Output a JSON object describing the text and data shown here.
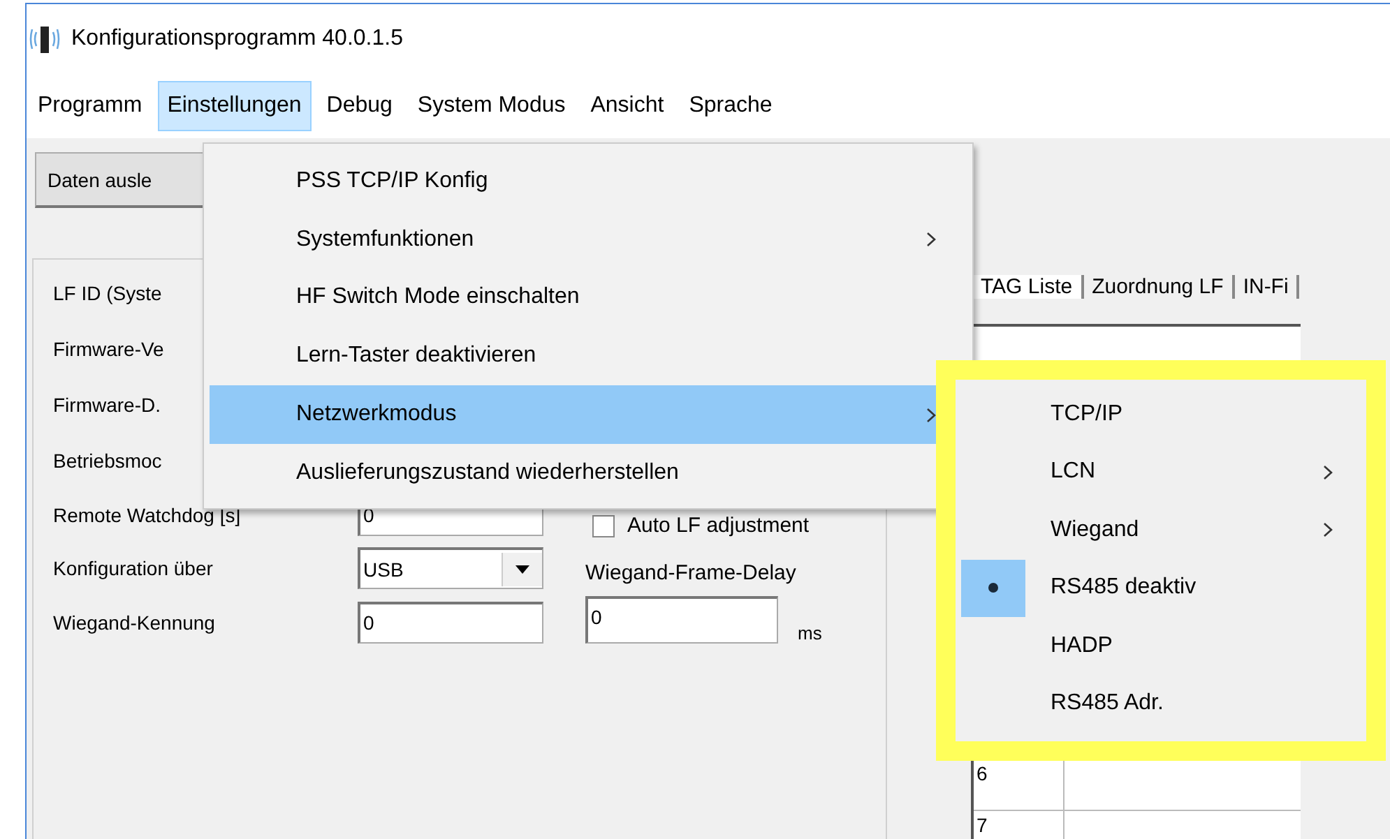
{
  "window": {
    "title": "Konfigurationsprogramm 40.0.1.5"
  },
  "menubar": [
    {
      "label": "Programm",
      "selected": false
    },
    {
      "label": "Einstellungen",
      "selected": true
    },
    {
      "label": "Debug",
      "selected": false
    },
    {
      "label": "System Modus",
      "selected": false
    },
    {
      "label": "Ansicht",
      "selected": false
    },
    {
      "label": "Sprache",
      "selected": false
    }
  ],
  "toolbar": {
    "button": "Daten ausle"
  },
  "left_panel": {
    "labels": [
      "LF ID (Syste",
      "Firmware-Ve",
      "Firmware-D.",
      "Betriebsmoc"
    ],
    "fields": [
      {
        "kind": "text",
        "label": "Remote Watchdog [s]",
        "value": "0"
      },
      {
        "kind": "combo",
        "label": "Konfiguration über",
        "value": "USB"
      },
      {
        "kind": "text",
        "label": "Wiegand-Kennung",
        "value": "0"
      }
    ],
    "auto_lf": {
      "label": "Auto LF adjustment",
      "checked": false
    },
    "frame_delay": {
      "label": "Wiegand-Frame-Delay",
      "value": "0",
      "unit": "ms"
    }
  },
  "right_panel": {
    "tabs": [
      {
        "label": "TAG Liste",
        "selected": true
      },
      {
        "label": "Zuordnung LF",
        "selected": false
      },
      {
        "label": "IN-Fi",
        "selected": false
      }
    ],
    "rows": [
      "6",
      "7"
    ]
  },
  "einstellungen_menu": [
    {
      "label": "PSS TCP/IP Konfig",
      "submenu": false,
      "selected": false
    },
    {
      "label": "Systemfunktionen",
      "submenu": true,
      "selected": false
    },
    {
      "label": "HF Switch Mode einschalten",
      "submenu": false,
      "selected": false
    },
    {
      "label": "Lern-Taster deaktivieren",
      "submenu": false,
      "selected": false
    },
    {
      "label": "Netzwerkmodus",
      "submenu": true,
      "selected": true
    },
    {
      "label": "Auslieferungszustand wiederherstellen",
      "submenu": false,
      "selected": false
    }
  ],
  "netzwerkmodus_menu": [
    {
      "label": "TCP/IP",
      "submenu": false,
      "checked": false
    },
    {
      "label": "LCN",
      "submenu": true,
      "checked": false
    },
    {
      "label": "Wiegand",
      "submenu": true,
      "checked": false
    },
    {
      "label": "RS485 deaktiv",
      "submenu": false,
      "checked": true
    },
    {
      "label": "HADP",
      "submenu": false,
      "checked": false
    },
    {
      "label": "RS485 Adr.",
      "submenu": false,
      "checked": false
    }
  ]
}
